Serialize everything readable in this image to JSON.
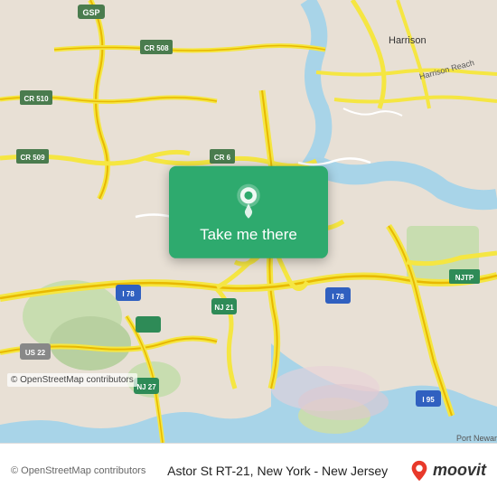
{
  "map": {
    "background_color": "#ede8df",
    "attribution": "© OpenStreetMap contributors",
    "osm_credit": "© OpenStreetMap contributors"
  },
  "overlay": {
    "button_label": "Take me there",
    "pin_icon": "map-pin"
  },
  "footer": {
    "title": "Astor St RT-21, New York - New Jersey",
    "moovit_text": "moovit"
  }
}
